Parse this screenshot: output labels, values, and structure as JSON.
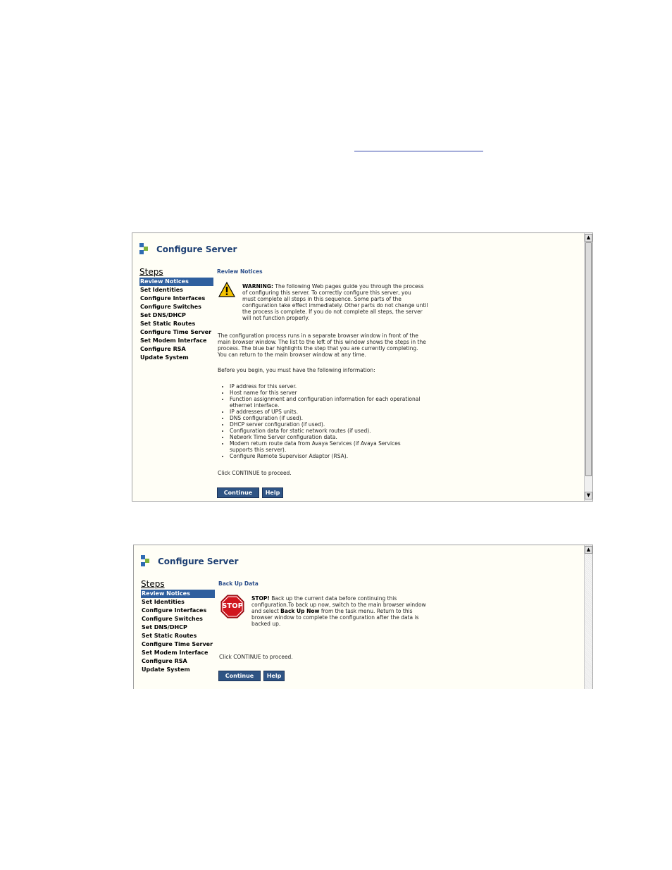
{
  "windows": [
    {
      "app_title": "Configure Server",
      "steps_title": "Steps",
      "steps": [
        "Review Notices",
        "Set Identities",
        "Configure Interfaces",
        "Configure Switches",
        "Set DNS/DHCP",
        "Set Static Routes",
        "Configure Time Server",
        "Set Modem Interface",
        "Configure RSA",
        "Update System"
      ],
      "active_step": "Review Notices",
      "section_title": "Review Notices",
      "warning_label": "WARNING:",
      "warning_lines": [
        "The following Web pages guide you through the process",
        "of configuring this server. To correctly configure this server, you",
        "must complete all steps in this sequence. Some parts of the",
        "configuration take effect immediately. Other parts do not change until",
        "the process is complete. If you do not complete all steps, the server",
        "will not function properly."
      ],
      "paragraph_lines": [
        "The configuration process runs in a separate browser window in front of the",
        "main browser window. The list to the left of this window shows the steps in the",
        "process. The blue bar highlights the step that you are currently completing.",
        "You can return to the main browser window at any time."
      ],
      "before_text": "Before you begin, you must have the following information:",
      "info_items": [
        "IP address for this server.",
        "Host name for this server",
        "Function assignment and configuration information for each operational ethernet interface.",
        "IP addresses of UPS units.",
        "DNS configuration (if used).",
        "DHCP server configuration (if used).",
        "Configuration data for static network routes (if used).",
        "Network Time Server configuration data.",
        "Modem return route data from Avaya Services (if Avaya Services supports this server).",
        "Configure Remote Supervisor Adaptor (RSA)."
      ],
      "proceed_text": "Click CONTINUE to proceed.",
      "continue_label": "Continue",
      "help_label": "Help",
      "scroll_up_glyph": "▲",
      "scroll_down_glyph": "▼"
    },
    {
      "app_title": "Configure Server",
      "steps_title": "Steps",
      "steps": [
        "Review Notices",
        "Set Identities",
        "Configure Interfaces",
        "Configure Switches",
        "Set DNS/DHCP",
        "Set Static Routes",
        "Configure Time Server",
        "Set Modem Interface",
        "Configure RSA",
        "Update System"
      ],
      "active_step": "Review Notices",
      "section_title": "Back Up Data",
      "stop_sign": "STOP",
      "stop_label": "STOP!",
      "stop_line1": "Back up the current data before continuing this",
      "stop_line2": "configuration.To back up now, switch to the main browser window",
      "stop_line3_pre": "and select ",
      "stop_line3_bold": "Back Up Now",
      "stop_line3_post": " from the task menu. Return to this",
      "stop_line4": "browser window to complete the configuration after the data is",
      "stop_line5": "backed up.",
      "proceed_text": "Click CONTINUE to proceed.",
      "continue_label": "Continue",
      "help_label": "Help",
      "scroll_up_glyph": "▲"
    }
  ],
  "colors": {
    "title_blue": "#1d3f73",
    "active_step_bg": "#2f5f9e",
    "button_bg": "#2f5484",
    "panel_bg": "#fffef6",
    "warning_yellow": "#f4c300",
    "stop_red": "#d0161e"
  }
}
